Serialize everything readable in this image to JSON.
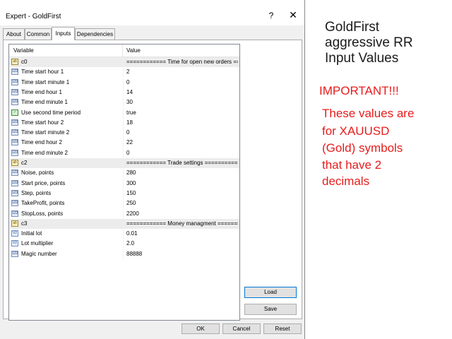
{
  "dialog": {
    "title": "Expert - GoldFirst",
    "help_glyph": "?",
    "close_glyph": "✕",
    "tabs": [
      {
        "label": "About"
      },
      {
        "label": "Common"
      },
      {
        "label": "Inputs"
      },
      {
        "label": "Dependencies"
      }
    ],
    "active_tab": "Inputs"
  },
  "grid": {
    "columns": [
      "Variable",
      "Value"
    ],
    "rows": [
      {
        "icon": "ab",
        "type": "string",
        "variable": "c0",
        "value": "============ Time for open new orders ==..."
      },
      {
        "icon": "123",
        "type": "int",
        "variable": "Time start hour 1",
        "value": "2"
      },
      {
        "icon": "123",
        "type": "int",
        "variable": "Time start minute 1",
        "value": "0"
      },
      {
        "icon": "123",
        "type": "int",
        "variable": "Time end hour 1",
        "value": "14"
      },
      {
        "icon": "123",
        "type": "int",
        "variable": "Time end minute 1",
        "value": "30"
      },
      {
        "icon": "✓",
        "type": "bool",
        "variable": "Use second time period",
        "value": "true"
      },
      {
        "icon": "123",
        "type": "int",
        "variable": "Time start hour 2",
        "value": "18"
      },
      {
        "icon": "123",
        "type": "int",
        "variable": "Time start minute 2",
        "value": "0"
      },
      {
        "icon": "123",
        "type": "int",
        "variable": "Time end hour 2",
        "value": "22"
      },
      {
        "icon": "123",
        "type": "int",
        "variable": "Time end minute 2",
        "value": "0"
      },
      {
        "icon": "ab",
        "type": "string",
        "variable": "c2",
        "value": "============ Trade settings ============..."
      },
      {
        "icon": "123",
        "type": "int",
        "variable": "Noise, points",
        "value": "280"
      },
      {
        "icon": "123",
        "type": "int",
        "variable": "Start price, points",
        "value": "300"
      },
      {
        "icon": "123",
        "type": "int",
        "variable": "Step, points",
        "value": "150"
      },
      {
        "icon": "123",
        "type": "int",
        "variable": "TakeProfit, points",
        "value": "250"
      },
      {
        "icon": "123",
        "type": "int",
        "variable": "StopLoss, points",
        "value": "2200"
      },
      {
        "icon": "ab",
        "type": "string",
        "variable": "c3",
        "value": "============ Money managment =======..."
      },
      {
        "icon": "V2",
        "type": "double",
        "variable": "Initial lot",
        "value": "0.01"
      },
      {
        "icon": "V2",
        "type": "double",
        "variable": "Lot multiplier",
        "value": "2.0"
      },
      {
        "icon": "123",
        "type": "int",
        "variable": "Magic number",
        "value": "88888"
      }
    ]
  },
  "side_buttons": {
    "load": "Load",
    "save": "Save"
  },
  "footer_buttons": {
    "ok": "OK",
    "cancel": "Cancel",
    "reset": "Reset"
  },
  "promo": {
    "title_lines": [
      "GoldFirst",
      "aggressive RR",
      "Input Values"
    ],
    "important": "IMPORTANT!!!",
    "note_lines": [
      "These values are",
      "for XAUUSD",
      "(Gold) symbols",
      "that have 2",
      "decimals"
    ]
  },
  "colors": {
    "accent_red": "#e81c1c",
    "focus_blue": "#0078d7"
  }
}
